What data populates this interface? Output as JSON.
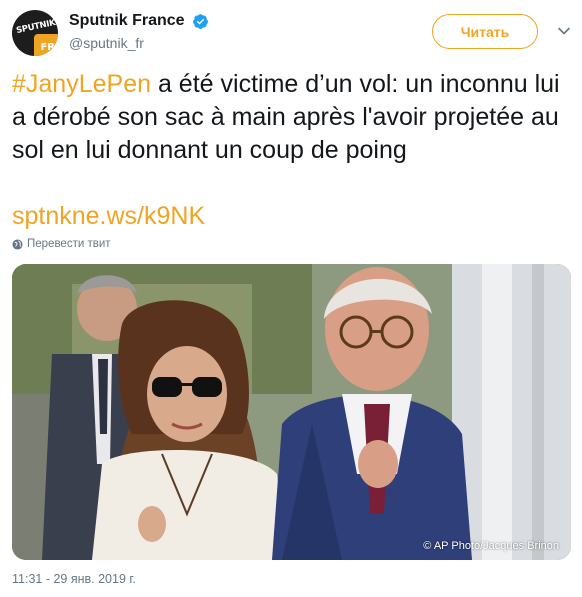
{
  "account": {
    "display_name": "Sputnik France",
    "handle": "@sputnik_fr",
    "avatar_text": "SPUTNIK",
    "avatar_badge": "FR",
    "verified_icon": "verified-badge-icon"
  },
  "follow_button": {
    "label": "Читать"
  },
  "menu": {
    "icon": "chevron-down-icon"
  },
  "tweet": {
    "hashtag": "#JanyLePen",
    "text": " a été victime d’un vol: un inconnu lui a dérobé son sac à main après l'avoir projetée au sol en lui donnant un coup de poing",
    "link": "sptnkne.ws/k9NK"
  },
  "translate": {
    "label": "Перевести твит",
    "icon": "globe-icon"
  },
  "photo": {
    "credit": "© AP Photo/Jacques Brinon"
  },
  "timestamp": "11:31 - 29 янв. 2019 г.",
  "colors": {
    "accent": "#f0a423",
    "text": "#14171a",
    "muted": "#657786",
    "verified": "#1da1f2"
  }
}
